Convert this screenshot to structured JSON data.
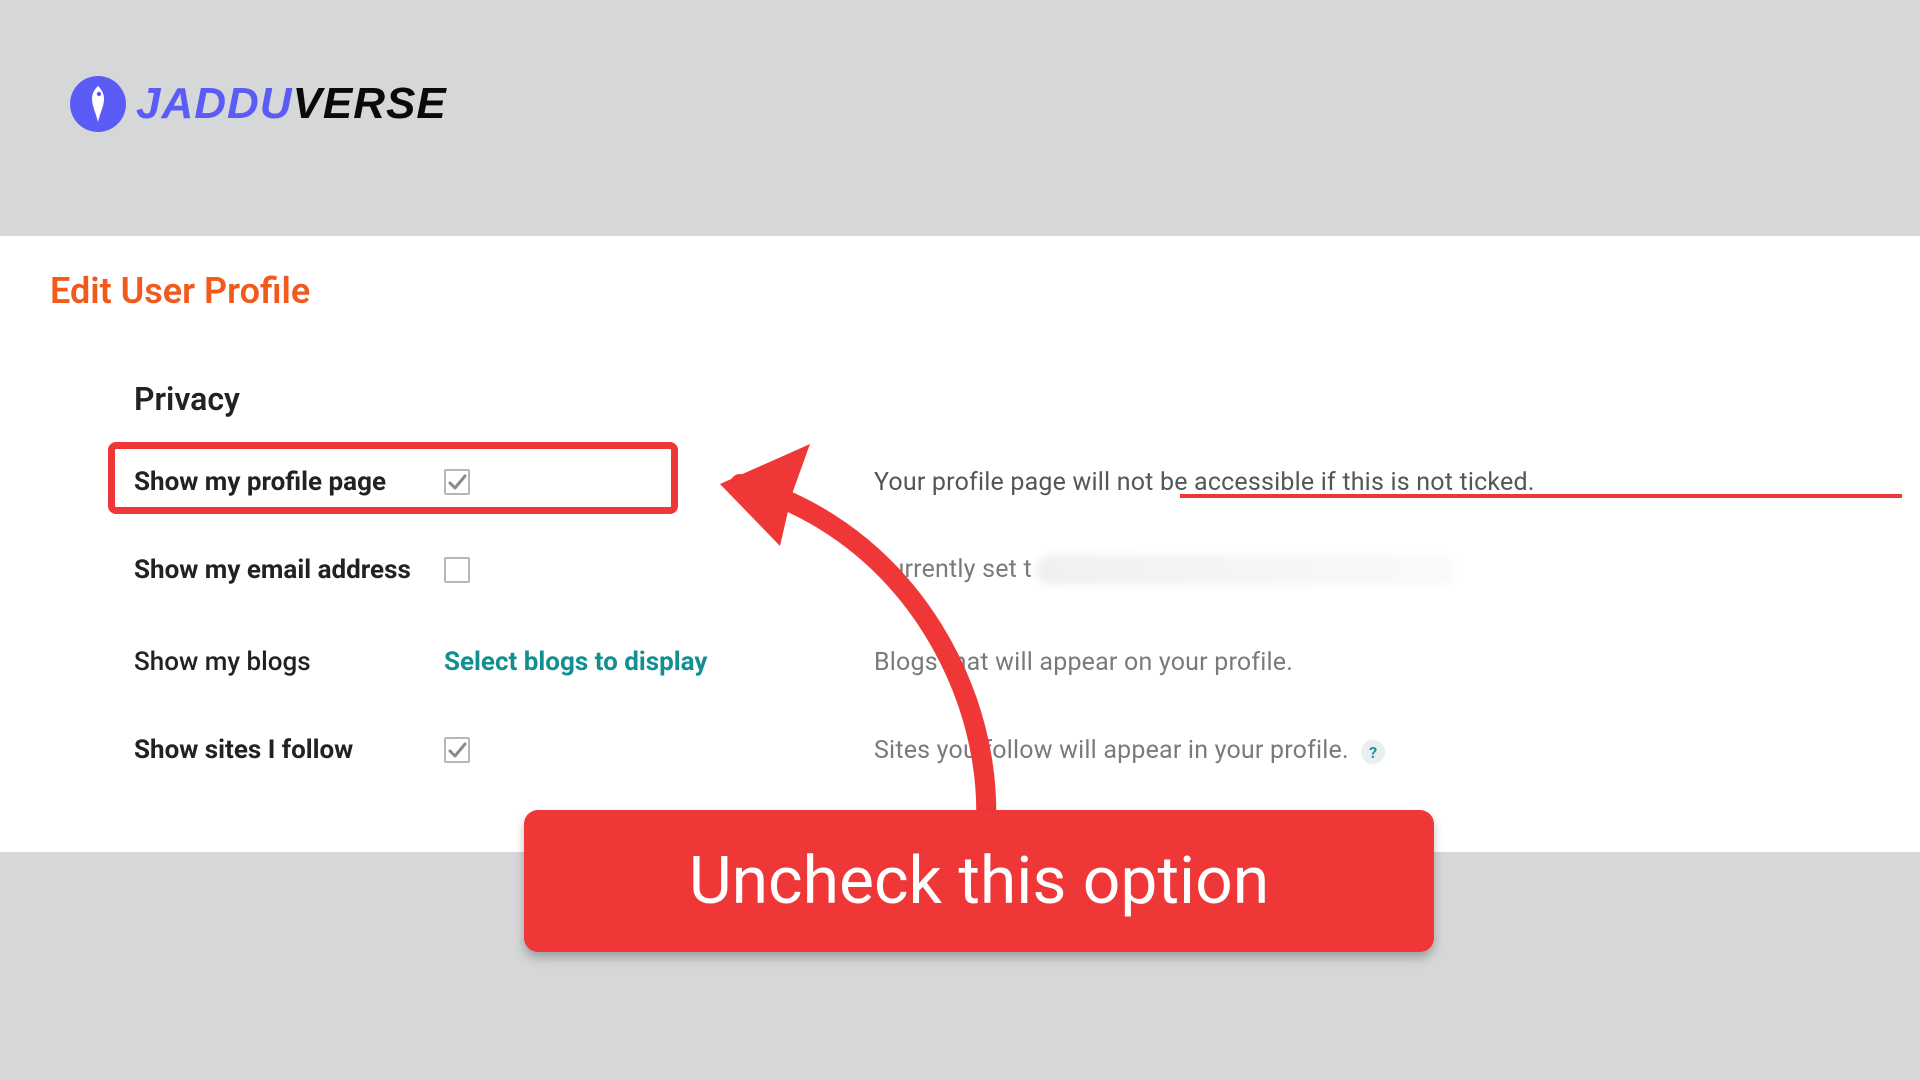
{
  "brand": {
    "part1": "JADDU",
    "part2": "VERSE"
  },
  "page": {
    "title": "Edit User Profile"
  },
  "privacy": {
    "title": "Privacy",
    "rows": {
      "profile": {
        "label": "Show my profile page",
        "checked": true,
        "desc": "Your profile page will not be accessible if this is not ticked."
      },
      "email": {
        "label": "Show my email address",
        "checked": false,
        "desc_prefix": "Currently set t"
      },
      "blogs": {
        "label": "Show my blogs",
        "link": "Select blogs to display",
        "desc": "Blogs that will appear on your profile."
      },
      "follow": {
        "label": "Show sites I follow",
        "checked": true,
        "desc": "Sites you follow will appear in your profile."
      }
    }
  },
  "help": {
    "glyph": "?"
  },
  "annotation": {
    "callout": "Uncheck this option"
  }
}
